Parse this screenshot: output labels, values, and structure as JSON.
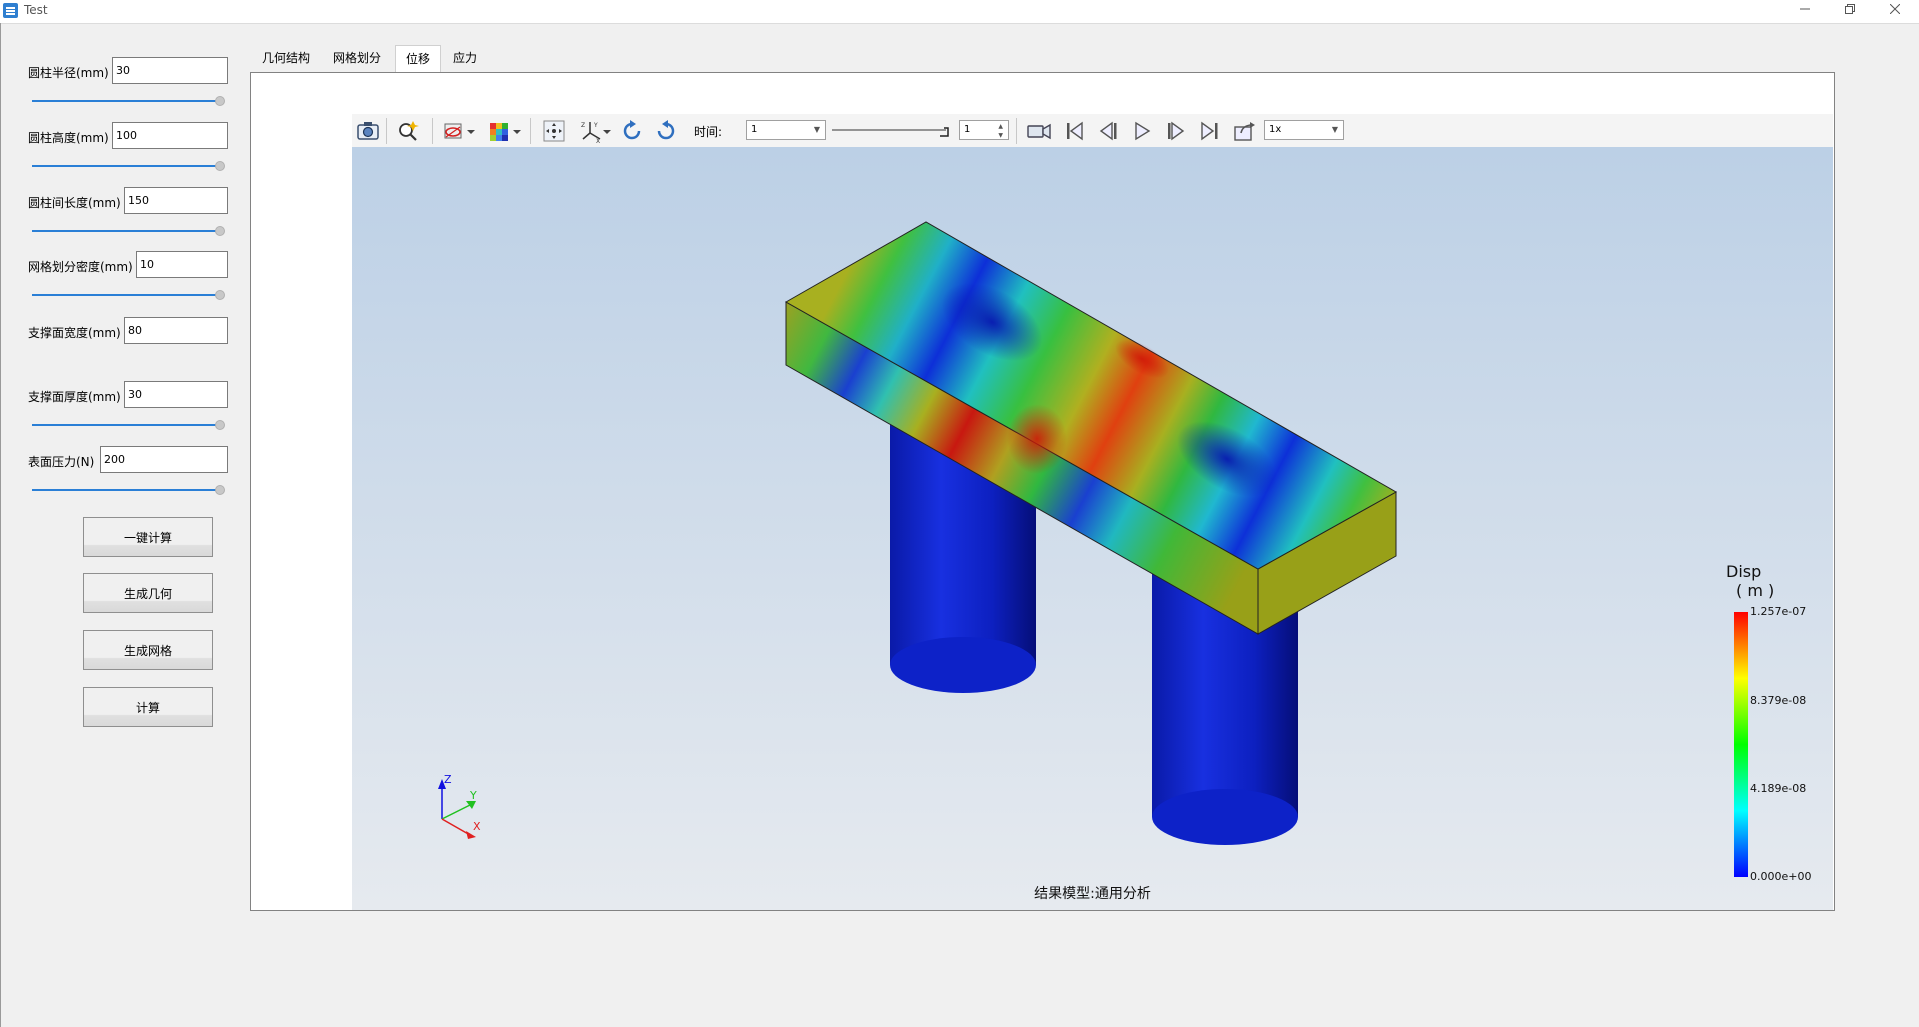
{
  "window": {
    "title": "Test"
  },
  "params": [
    {
      "label": "圆柱半径(mm)",
      "value": "30"
    },
    {
      "label": "圆柱高度(mm)",
      "value": "100"
    },
    {
      "label": "圆柱间长度(mm)",
      "value": "150"
    },
    {
      "label": "网格划分密度(mm)",
      "value": "10"
    },
    {
      "label": "支撑面宽度(mm)",
      "value": "80"
    },
    {
      "label": "支撑面厚度(mm)",
      "value": "30"
    },
    {
      "label": "表面压力(N)",
      "value": "200"
    }
  ],
  "buttons": {
    "one_click": "一键计算",
    "gen_geometry": "生成几何",
    "gen_mesh": "生成网格",
    "compute": "计算"
  },
  "tabs": [
    "几何结构",
    "网格划分",
    "位移",
    "应力"
  ],
  "active_tab": "位移",
  "toolbar": {
    "time_label": "时间:",
    "time_value": "1",
    "frame_value": "1",
    "speed_value": "1x"
  },
  "viewer": {
    "caption": "结果模型:通用分析",
    "axes": {
      "z": "Z",
      "y": "Y",
      "x": "X"
    }
  },
  "legend": {
    "title": "Disp",
    "unit": "( m )",
    "ticks": [
      "1.257e-07",
      "8.379e-08",
      "4.189e-08",
      "0.000e+00"
    ],
    "colors": {
      "max": "#ff0000",
      "high": "#ffff00",
      "mid": "#00ff00",
      "low": "#00ffff",
      "min": "#0000ff"
    }
  }
}
